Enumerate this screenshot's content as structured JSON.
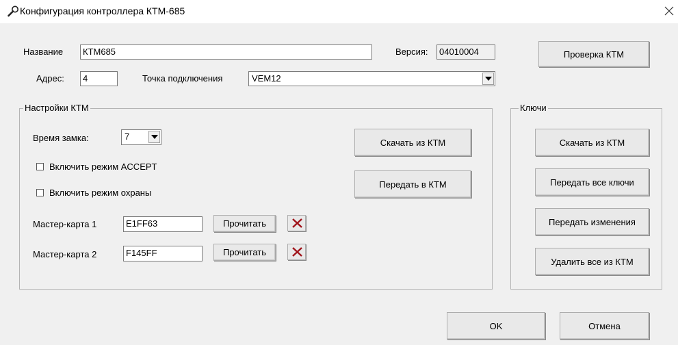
{
  "window": {
    "title": "Конфигурация контроллера КТМ-685"
  },
  "top": {
    "name_label": "Название",
    "name_value": "КТМ685",
    "version_label": "Версия:",
    "version_value": "04010004",
    "check_button": "Проверка КТМ",
    "address_label": "Адрес:",
    "address_value": "4",
    "connection_label": "Точка подключения",
    "connection_value": "VEM12"
  },
  "settings": {
    "title": "Настройки КТМ",
    "lock_time_label": "Время замка:",
    "lock_time_value": "7",
    "accept_mode_label": "Включить режим ACCEPT",
    "accept_mode_checked": false,
    "guard_mode_label": "Включить режим охраны",
    "guard_mode_checked": false,
    "download_button": "Скачать из КТМ",
    "upload_button": "Передать в КТМ",
    "master1_label": "Мастер-карта 1",
    "master1_value": "E1FF63",
    "master1_read": "Прочитать",
    "master2_label": "Мастер-карта 2",
    "master2_value": "F145FF",
    "master2_read": "Прочитать",
    "delete_icon_color": "#a0131a"
  },
  "keys": {
    "title": "Ключи",
    "download_button": "Скачать из КТМ",
    "upload_all_button": "Передать все ключи",
    "upload_changes_button": "Передать изменения",
    "delete_all_button": "Удалить все из КТМ"
  },
  "footer": {
    "ok_button": "OK",
    "cancel_button": "Отмена"
  }
}
